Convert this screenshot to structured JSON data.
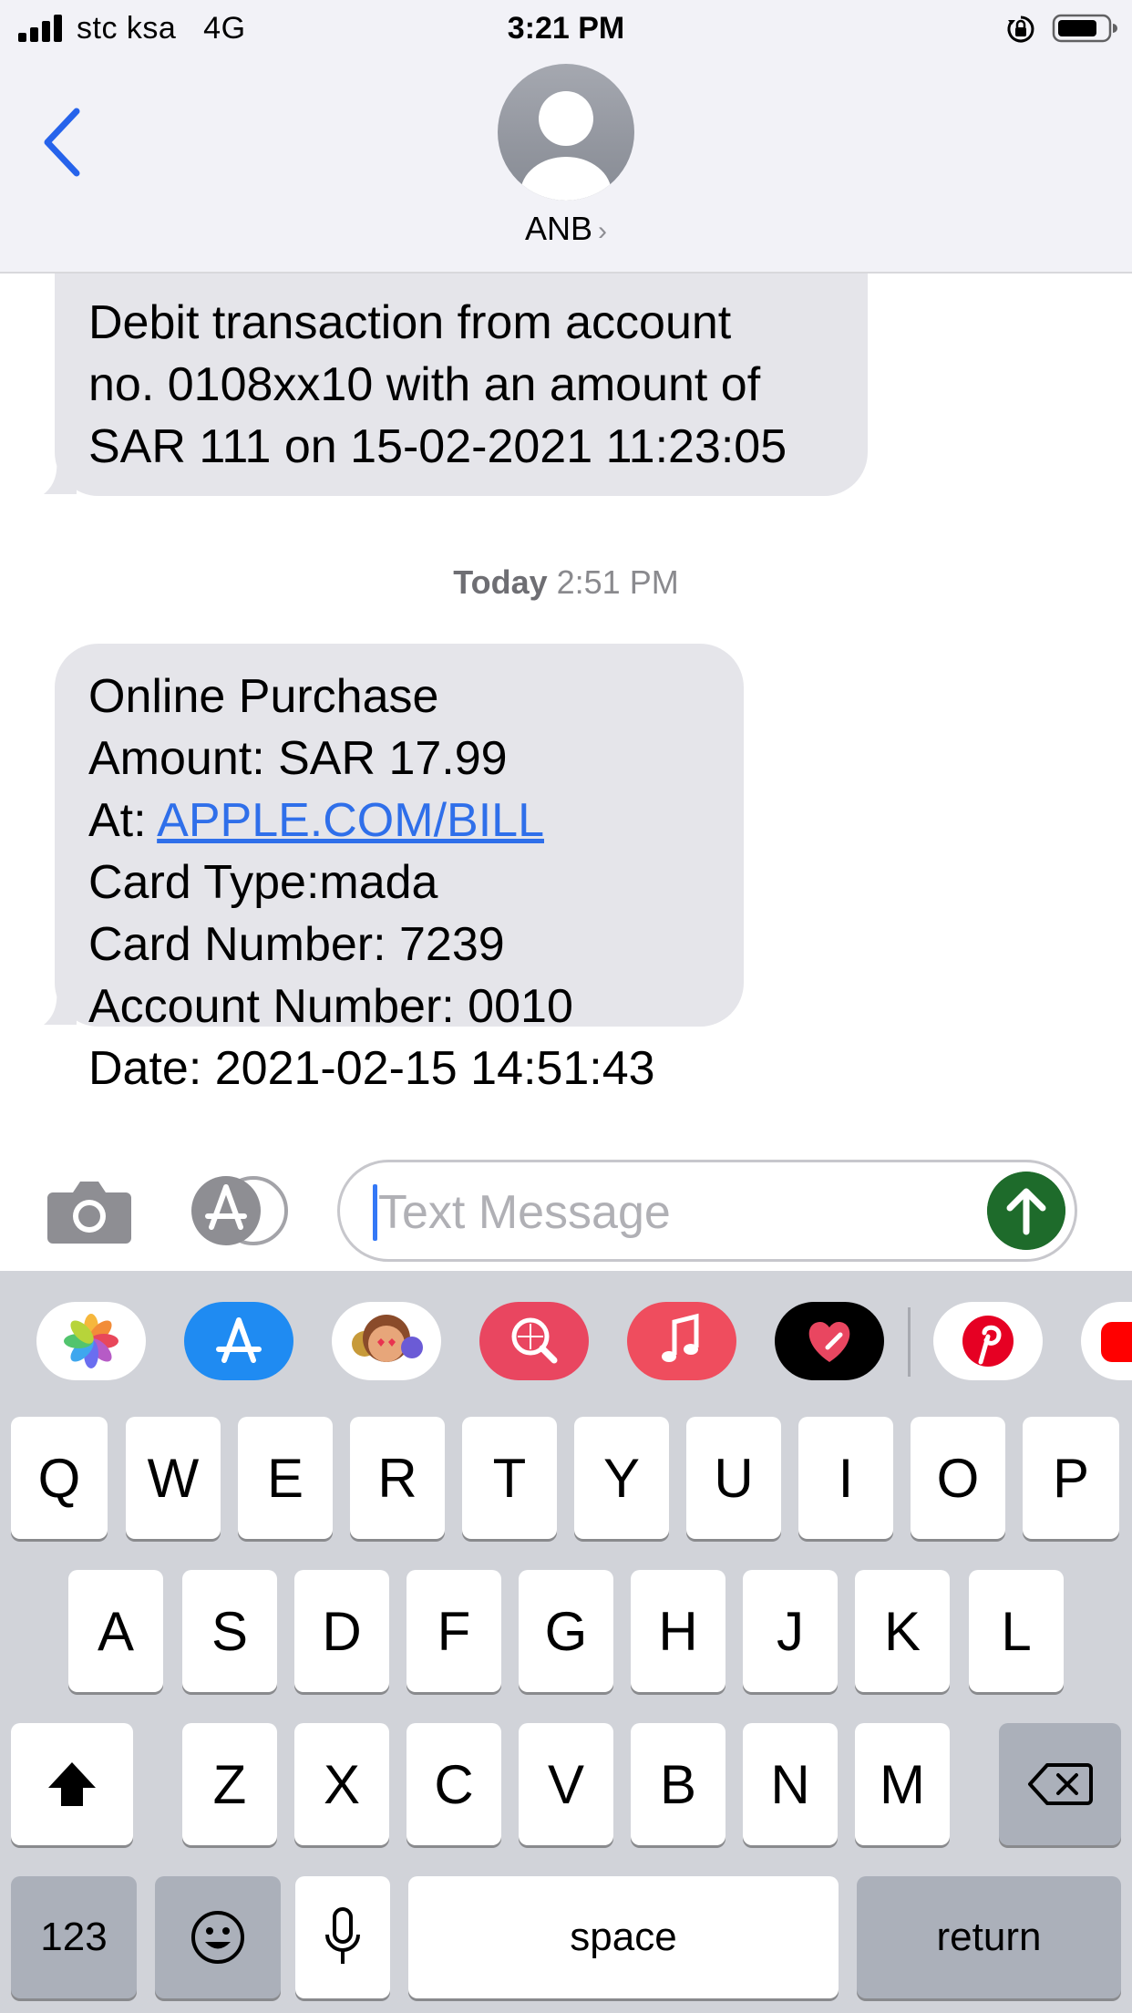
{
  "status_bar": {
    "carrier": "stc ksa",
    "network": "4G",
    "time": "3:21 PM",
    "icons": [
      "signal-icon",
      "orientation-lock-icon",
      "battery-icon"
    ]
  },
  "header": {
    "contact_name": "ANB",
    "chevron": "›",
    "icons": [
      "back-chevron-icon",
      "person-icon"
    ]
  },
  "messages": [
    {
      "lines": [
        "Debit transaction from account",
        "no. 0108xx10 with an amount of",
        "SAR 111 on 15-02-2021 11:23:05"
      ]
    },
    {
      "lines": [
        "Online Purchase",
        "Amount: SAR 17.99",
        "At: ",
        "Card Type:mada",
        "Card Number: 7239",
        "Account Number: 0010",
        "Date: 2021-02-15 14:51:43"
      ],
      "link": "APPLE.COM/BILL"
    }
  ],
  "timestamp": {
    "day": "Today",
    "time": "2:51 PM"
  },
  "input_bar": {
    "placeholder": "Text Message",
    "icons": [
      "camera-icon",
      "app-store-icon",
      "send-arrow-icon"
    ],
    "send_color": "#1e6b2b"
  },
  "app_drawer": {
    "apps": [
      "photos-icon",
      "app-store-icon",
      "memoji-icon",
      "web-search-icon",
      "music-icon",
      "digital-touch-icon",
      "pinterest-icon",
      "youtube-icon"
    ]
  },
  "keyboard": {
    "row1": [
      "Q",
      "W",
      "E",
      "R",
      "T",
      "Y",
      "U",
      "I",
      "O",
      "P"
    ],
    "row2": [
      "A",
      "S",
      "D",
      "F",
      "G",
      "H",
      "J",
      "K",
      "L"
    ],
    "row3": [
      "Z",
      "X",
      "C",
      "V",
      "B",
      "N",
      "M"
    ],
    "numbers_label": "123",
    "space_label": "space",
    "return_label": "return",
    "icons": [
      "shift-icon",
      "delete-icon",
      "emoji-icon",
      "microphone-icon"
    ]
  }
}
